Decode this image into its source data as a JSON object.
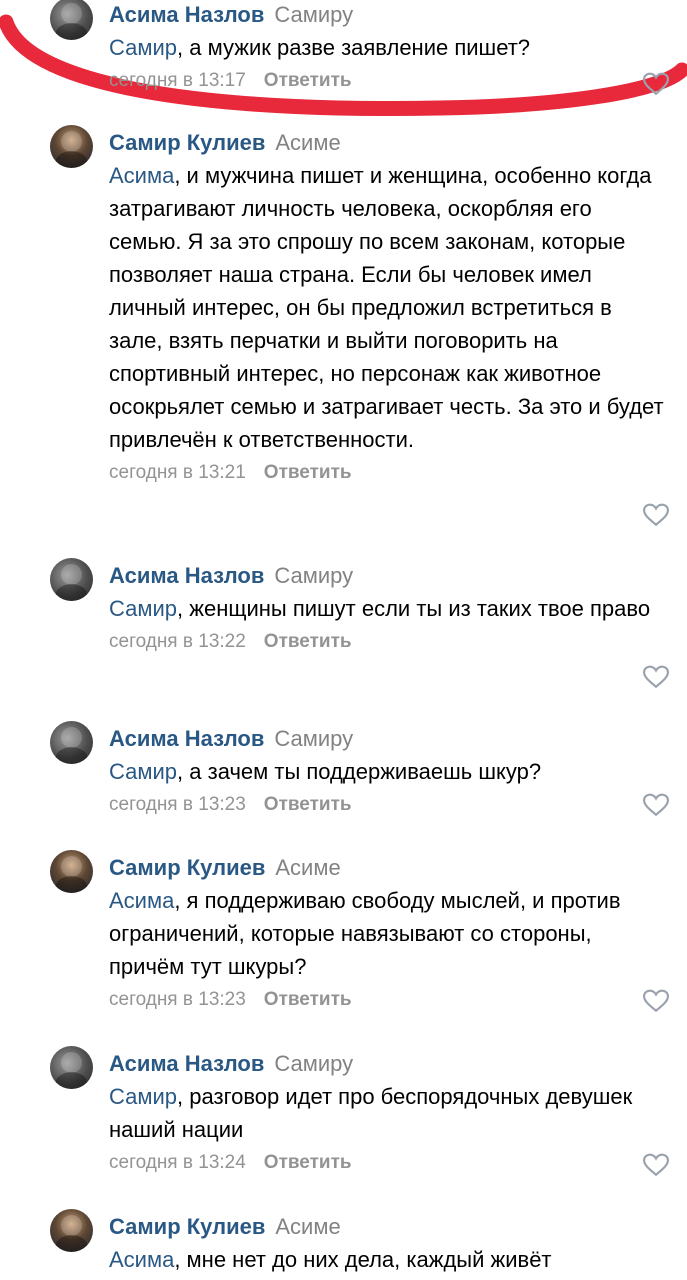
{
  "comments": [
    {
      "author": "Асима Назлов",
      "to": "Самиру",
      "addressee": "Самир",
      "text": ", а мужик разве заявление пишет?",
      "date": "сегодня в 13:17",
      "reply": "Ответить",
      "avatar": "asima-avatar"
    },
    {
      "author": "Самир Кулиев",
      "to": "Асиме",
      "addressee": "Асима",
      "text": ", и мужчина пишет и женщина, особенно когда затрагивают личность человека, оскорбляя его семью. Я за это спрошу по всем законам, которые позволяет наша страна. Если бы человек имел личный интерес, он бы предложил встретиться в зале, взять перчатки и выйти поговорить на спортивный интерес, но персонаж как животное осокрьялет семью и затрагивает честь. За это и будет привлечён к ответственности.",
      "date": "сегодня в 13:21",
      "reply": "Ответить",
      "avatar": "samir-avatar"
    },
    {
      "author": "Асима Назлов",
      "to": "Самиру",
      "addressee": "Самир",
      "text": ", женщины пишут если ты из таких твое право",
      "date": "сегодня в 13:22",
      "reply": "Ответить",
      "avatar": "asima-avatar"
    },
    {
      "author": "Асима Назлов",
      "to": "Самиру",
      "addressee": "Самир",
      "text": ", а зачем ты поддерживаешь шкур?",
      "date": "сегодня в 13:23",
      "reply": "Ответить",
      "avatar": "asima-avatar"
    },
    {
      "author": "Самир Кулиев",
      "to": "Асиме",
      "addressee": "Асима",
      "text": ", я поддерживаю свободу мыслей, и против ограничений, которые навязывают со стороны, причём тут шкуры?",
      "date": "сегодня в 13:23",
      "reply": "Ответить",
      "avatar": "samir-avatar"
    },
    {
      "author": "Асима Назлов",
      "to": "Самиру",
      "addressee": "Самир",
      "text": ", разговор идет про беспорядочных девушек наший нации",
      "date": "сегодня в 13:24",
      "reply": "Ответить",
      "avatar": "asima-avatar"
    },
    {
      "author": "Самир Кулиев",
      "to": "Асиме",
      "addressee": "Асима",
      "text": ", мне нет до них дела, каждый живёт",
      "date": "",
      "reply": "",
      "avatar": "samir-avatar"
    }
  ],
  "icons": {
    "like": "heart-outline-icon"
  },
  "colors": {
    "author": "#2a5885",
    "meta": "#939393",
    "annotation": "#e8283b"
  }
}
